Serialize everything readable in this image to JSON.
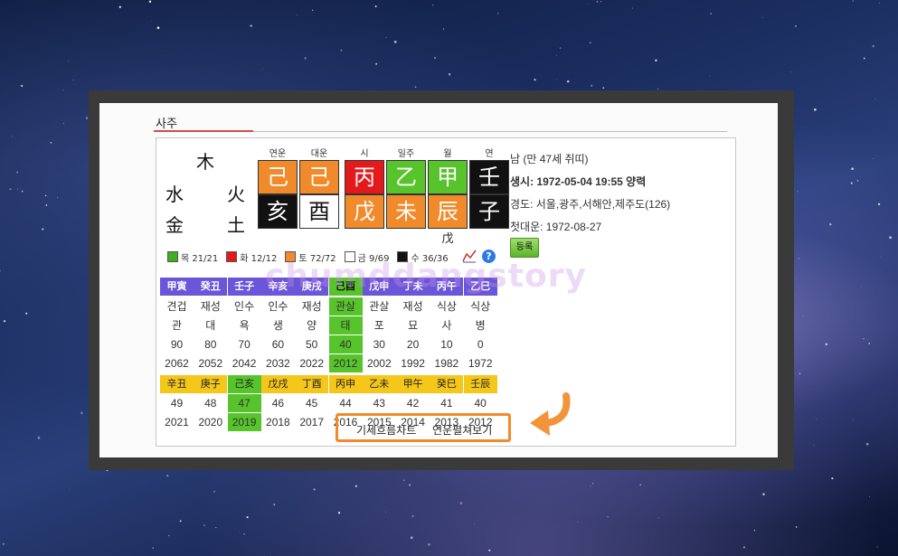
{
  "section_title": "사주",
  "elements": {
    "wood": "木",
    "water": "水",
    "fire": "火",
    "metal": "金",
    "earth": "土"
  },
  "pillars": [
    {
      "label": "연운",
      "top": "己",
      "bottom": "亥",
      "top_bg": "#f08a2a",
      "top_fg": "#ffffff",
      "bottom_bg": "#111111",
      "bottom_fg": "#ffffff",
      "below": ""
    },
    {
      "label": "대운",
      "top": "己",
      "bottom": "酉",
      "top_bg": "#f08a2a",
      "top_fg": "#ffffff",
      "bottom_bg": "#ffffff",
      "bottom_fg": "#111111",
      "below": ""
    },
    {
      "label": "시",
      "top": "丙",
      "bottom": "戊",
      "top_bg": "#e3191b",
      "top_fg": "#ffffff",
      "bottom_bg": "#f08a2a",
      "bottom_fg": "#ffffff",
      "below": ""
    },
    {
      "label": "일주",
      "top": "乙",
      "bottom": "未",
      "top_bg": "#57c42b",
      "top_fg": "#ffffff",
      "bottom_bg": "#f08a2a",
      "bottom_fg": "#ffffff",
      "below": ""
    },
    {
      "label": "월",
      "top": "甲",
      "bottom": "辰",
      "top_bg": "#57c42b",
      "top_fg": "#ffffff",
      "bottom_bg": "#f08a2a",
      "bottom_fg": "#ffffff",
      "below": "戊"
    },
    {
      "label": "연",
      "top": "壬",
      "bottom": "子",
      "top_bg": "#111111",
      "top_fg": "#ffffff",
      "bottom_bg": "#111111",
      "bottom_fg": "#ffffff",
      "below": ""
    }
  ],
  "legend": [
    {
      "color": "#3fae1f",
      "text": "목 21/21"
    },
    {
      "color": "#e3191b",
      "text": "화 12/12"
    },
    {
      "color": "#f08a2a",
      "text": "토 72/72"
    },
    {
      "color": "#ffffff",
      "text": "금 9/69"
    },
    {
      "color": "#111111",
      "text": "수 36/36"
    }
  ],
  "info": {
    "gender_age": "남 (만 47세 쥐띠)",
    "birth": "생시: 1972-05-04 19:55 양력",
    "longitude": "경도: 서울,광주,서해안,제주도(126)",
    "first_daeun": "첫대운: 1972-08-27",
    "register_label": "등록"
  },
  "daeun_table": {
    "header": [
      "甲寅",
      "癸丑",
      "壬子",
      "辛亥",
      "庚戌",
      "己酉",
      "戊申",
      "丁未",
      "丙午",
      "乙巳"
    ],
    "sipsin": [
      "견겁",
      "재성",
      "인수",
      "인수",
      "재성",
      "관살",
      "관살",
      "재성",
      "식상",
      "식상"
    ],
    "unseong": [
      "관",
      "대",
      "욕",
      "생",
      "양",
      "태",
      "포",
      "묘",
      "사",
      "병"
    ],
    "age": [
      "90",
      "80",
      "70",
      "60",
      "50",
      "40",
      "30",
      "20",
      "10",
      "0"
    ],
    "year": [
      "2062",
      "2052",
      "2042",
      "2032",
      "2022",
      "2012",
      "2002",
      "1992",
      "1982",
      "1972"
    ],
    "highlight_index": 5
  },
  "yeonun_table": {
    "header": [
      "辛丑",
      "庚子",
      "己亥",
      "戊戌",
      "丁酉",
      "丙申",
      "乙未",
      "甲午",
      "癸巳",
      "壬辰"
    ],
    "age": [
      "49",
      "48",
      "47",
      "46",
      "45",
      "44",
      "43",
      "42",
      "41",
      "40"
    ],
    "year": [
      "2021",
      "2020",
      "2019",
      "2018",
      "2017",
      "2016",
      "2015",
      "2014",
      "2013",
      "2012"
    ],
    "highlight_index": 2
  },
  "watermark": "chumddangstory",
  "links": {
    "chart": "기세흐름차트",
    "expand": "연운펼쳐보기"
  }
}
